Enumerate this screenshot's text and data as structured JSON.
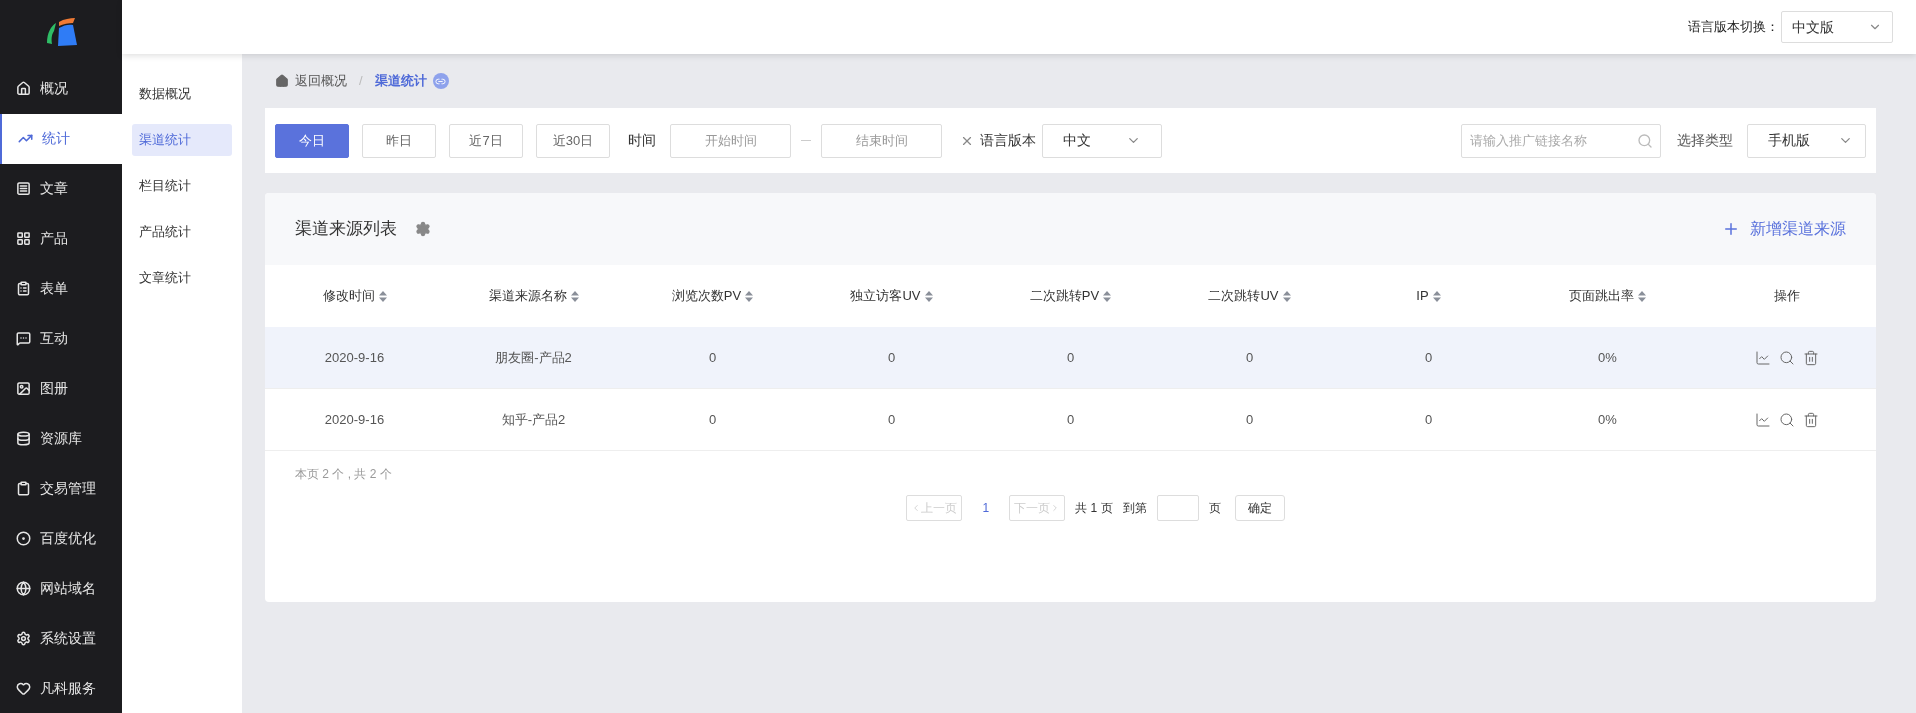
{
  "header": {
    "language_label": "语言版本切换：",
    "language_select": "中文版"
  },
  "sidebar": {
    "items": [
      {
        "label": "概况",
        "selected": false
      },
      {
        "label": "统计",
        "selected": true
      },
      {
        "label": "文章",
        "selected": false
      },
      {
        "label": "产品",
        "selected": false
      },
      {
        "label": "表单",
        "selected": false
      },
      {
        "label": "互动",
        "selected": false
      },
      {
        "label": "图册",
        "selected": false
      },
      {
        "label": "资源库",
        "selected": false
      },
      {
        "label": "交易管理",
        "selected": false
      },
      {
        "label": "百度优化",
        "selected": false
      },
      {
        "label": "网站域名",
        "selected": false
      },
      {
        "label": "系统设置",
        "selected": false
      },
      {
        "label": "凡科服务",
        "selected": false
      }
    ]
  },
  "subnav": {
    "items": [
      {
        "label": "数据概况",
        "selected": false
      },
      {
        "label": "渠道统计",
        "selected": true
      },
      {
        "label": "栏目统计",
        "selected": false
      },
      {
        "label": "产品统计",
        "selected": false
      },
      {
        "label": "文章统计",
        "selected": false
      }
    ]
  },
  "breadcrumb": {
    "back": "返回概况",
    "separator": "/",
    "current": "渠道统计"
  },
  "filters": {
    "quick_ranges": [
      {
        "label": "今日",
        "selected": true
      },
      {
        "label": "昨日",
        "selected": false
      },
      {
        "label": "近7日",
        "selected": false
      },
      {
        "label": "近30日",
        "selected": false
      }
    ],
    "time_label": "时间",
    "start_placeholder": "开始时间",
    "end_placeholder": "结束时间",
    "language_label": "语言版本",
    "language_value": "中文",
    "search_placeholder": "请输入推广链接名称",
    "type_label": "选择类型",
    "type_value": "手机版"
  },
  "card": {
    "title": "渠道来源列表",
    "add_button": "新增渠道来源",
    "columns": [
      {
        "label": "修改时间",
        "sortable": true
      },
      {
        "label": "渠道来源名称",
        "sortable": true
      },
      {
        "label": "浏览次数PV",
        "sortable": true
      },
      {
        "label": "独立访客UV",
        "sortable": true
      },
      {
        "label": "二次跳转PV",
        "sortable": true
      },
      {
        "label": "二次跳转UV",
        "sortable": true
      },
      {
        "label": "IP",
        "sortable": true
      },
      {
        "label": "页面跳出率",
        "sortable": true
      },
      {
        "label": "操作",
        "sortable": false
      }
    ],
    "rows": [
      {
        "selected": true,
        "cells": [
          "2020-9-16",
          "朋友圈-产品2",
          "0",
          "0",
          "0",
          "0",
          "0",
          "0%"
        ]
      },
      {
        "selected": false,
        "cells": [
          "2020-9-16",
          "知乎-产品2",
          "0",
          "0",
          "0",
          "0",
          "0",
          "0%"
        ]
      }
    ],
    "summary": "本页 2 个 , 共 2 个",
    "pagination": {
      "prev": "上一页",
      "prev_disabled": true,
      "pages": [
        {
          "label": "1",
          "selected": true
        }
      ],
      "next": "下一页",
      "next_disabled": true,
      "total": "共 1 页",
      "goto_label": "到第",
      "page_unit": "页",
      "confirm": "确定"
    }
  }
}
